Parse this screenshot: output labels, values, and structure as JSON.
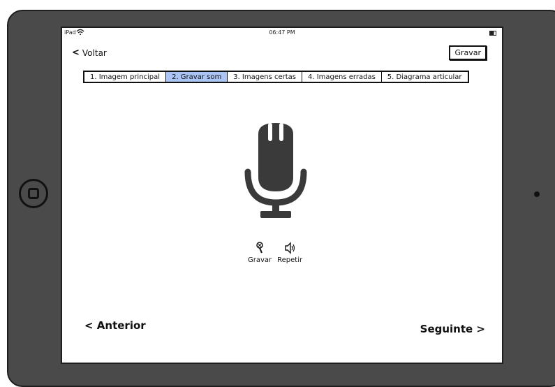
{
  "status_bar": {
    "device": "iPad",
    "time": "06:47 PM"
  },
  "nav": {
    "back_label": "Voltar",
    "record_button": "Gravar"
  },
  "tabs": [
    {
      "label": "1. Imagem principal"
    },
    {
      "label": "2. Gravar som",
      "active": true
    },
    {
      "label": "3. Imagens certas"
    },
    {
      "label": "4. Imagens erradas"
    },
    {
      "label": "5. Diagrama articular"
    }
  ],
  "actions": {
    "record_label": "Gravar",
    "repeat_label": "Repetir"
  },
  "footer": {
    "previous": "< Anterior",
    "next": "Seguinte >"
  },
  "colors": {
    "active_tab": "#a9c4f5",
    "mic": "#3a3a3a",
    "frame": "#4a4a4a"
  },
  "icons": [
    "wifi-icon",
    "battery-icon",
    "back-chevron-icon",
    "microphone-icon",
    "record-mic-icon",
    "speaker-icon",
    "home-button-icon"
  ]
}
